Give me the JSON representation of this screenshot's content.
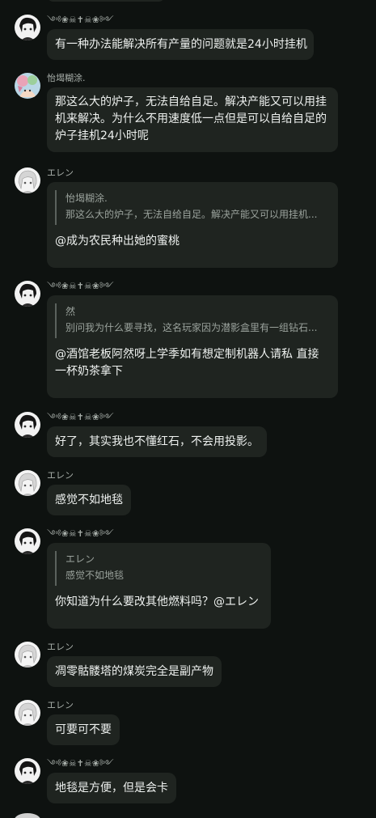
{
  "messages": [
    {
      "type": "text",
      "avatar": "avatar-black-hair-icon",
      "name": "༺❀☠✝☠❀༻",
      "text": "有一种办法能解决所有产量的问题就是24小时挂机"
    },
    {
      "type": "text",
      "avatar": "avatar-pastel-character-icon",
      "name": "怡堨糊涂.",
      "text": "那这么大的炉子，无法自给自足。解决产能又可以用挂机来解决。为什么不用速度低一点但是可以自给自足的炉子挂机24小时呢"
    },
    {
      "type": "reply",
      "avatar": "avatar-white-hair-icon",
      "name": "エレン",
      "quote_name": "怡堨糊涂.",
      "quote_text": "那这么大的炉子，无法自给自足。解决产能又可以用挂机...",
      "text": "@成为农民种出她的蜜桃"
    },
    {
      "type": "reply",
      "avatar": "avatar-black-hair-icon",
      "name": "༺❀☠✝☠❀༻",
      "quote_name": "然",
      "quote_text": "别问我为什么要寻找，这名玩家因为潜影盒里有一组钻石...",
      "text": "@酒馆老板阿然呀上学季如有想定制机器人请私 直接一杯奶茶拿下"
    },
    {
      "type": "text",
      "avatar": "avatar-black-hair-icon",
      "name": "༺❀☠✝☠❀༻",
      "text": "好了，其实我也不懂红石，不会用投影。"
    },
    {
      "type": "text",
      "avatar": "avatar-white-hair-icon",
      "name": "エレン",
      "text": "感觉不如地毯"
    },
    {
      "type": "reply",
      "avatar": "avatar-black-hair-icon",
      "name": "༺❀☠✝☠❀༻",
      "quote_name": "エレン",
      "quote_text": "感觉不如地毯",
      "text": "你知道为什么要改其他燃料吗？@エレン"
    },
    {
      "type": "text",
      "avatar": "avatar-white-hair-icon",
      "name": "エレン",
      "text": "凋零骷髅塔的煤炭完全是副产物"
    },
    {
      "type": "text",
      "avatar": "avatar-white-hair-icon",
      "name": "エレン",
      "text": "可要可不要"
    },
    {
      "type": "text",
      "avatar": "avatar-black-hair-icon",
      "name": "༺❀☠✝☠❀༻",
      "text": "地毯是方便，但是会卡"
    }
  ]
}
